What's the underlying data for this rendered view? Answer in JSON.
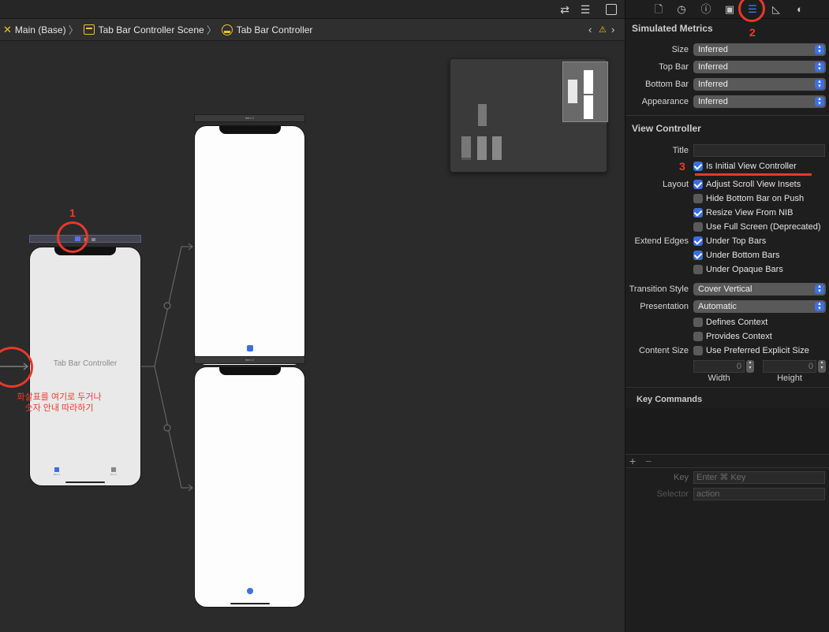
{
  "toolbar": {
    "icons": [
      "swap-arrows-icon",
      "lines-icon",
      "panel-icon"
    ]
  },
  "breadcrumb": {
    "items": [
      "Main (Base)",
      "Tab Bar Controller Scene",
      "Tab Bar Controller"
    ]
  },
  "canvas": {
    "tab_bar_controller_label": "Tab Bar Controller",
    "item1_bar": "Item 1",
    "item2_bar": "Item 2",
    "tab_item1": "Item 1",
    "tab_item2": "Item 2"
  },
  "annotations": {
    "num1": "1",
    "num2": "2",
    "num3": "3",
    "hint_line1": "화살표를 여기로 두거나",
    "hint_line2": "숫자 안내 따라하기",
    "color": "#e8382b"
  },
  "inspector": {
    "tabs": [
      "file-icon",
      "history-icon",
      "help-icon",
      "identity-icon",
      "attributes-icon",
      "size-icon",
      "connections-icon"
    ],
    "simulated_metrics": {
      "title": "Simulated Metrics",
      "rows": [
        {
          "label": "Size",
          "value": "Inferred"
        },
        {
          "label": "Top Bar",
          "value": "Inferred"
        },
        {
          "label": "Bottom Bar",
          "value": "Inferred"
        },
        {
          "label": "Appearance",
          "value": "Inferred"
        }
      ]
    },
    "view_controller": {
      "title": "View Controller",
      "title_label": "Title",
      "title_value": "",
      "initial_vc": "Is Initial View Controller",
      "layout_label": "Layout",
      "layout_options": [
        "Adjust Scroll View Insets",
        "Hide Bottom Bar on Push",
        "Resize View From NIB",
        "Use Full Screen (Deprecated)"
      ],
      "extend_edges_label": "Extend Edges",
      "extend_edges_options": [
        "Under Top Bars",
        "Under Bottom Bars",
        "Under Opaque Bars"
      ],
      "transition_style_label": "Transition Style",
      "transition_style_value": "Cover Vertical",
      "presentation_label": "Presentation",
      "presentation_value": "Automatic",
      "defines_context": "Defines Context",
      "provides_context": "Provides Context",
      "content_size_label": "Content Size",
      "use_preferred": "Use Preferred Explicit Size",
      "width_value": "0",
      "height_value": "0",
      "width_label": "Width",
      "height_label": "Height"
    },
    "key_commands": {
      "title": "Key Commands",
      "add": "+",
      "remove": "−",
      "key_label": "Key",
      "key_placeholder": "Enter ⌘ Key",
      "selector_label": "Selector",
      "selector_placeholder": "action"
    }
  }
}
